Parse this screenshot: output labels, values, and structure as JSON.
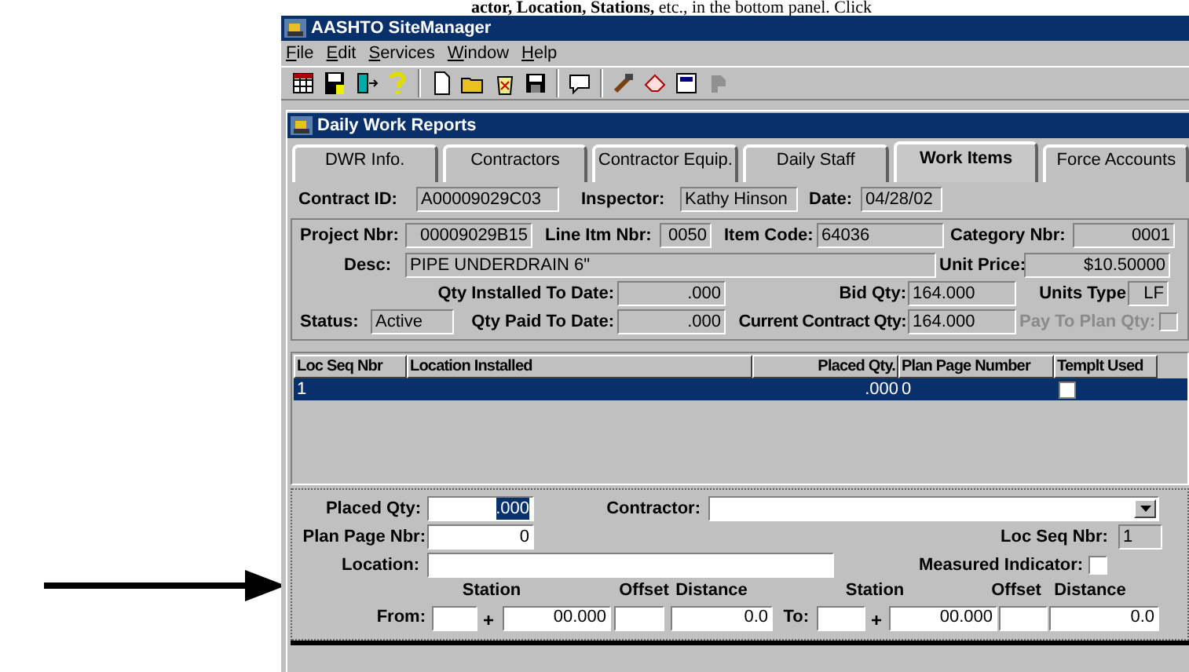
{
  "document_text": "**actor, Location, Stations,** etc., in the bottom panel.  Click",
  "app": {
    "title": "AASHTO SiteManager",
    "menu": [
      "File",
      "Edit",
      "Services",
      "Window",
      "Help"
    ]
  },
  "dialog": {
    "title": "Daily Work Reports",
    "tabs": [
      {
        "label": "DWR Info.",
        "selected": false
      },
      {
        "label": "Contractors",
        "selected": false
      },
      {
        "label": "Contractor Equip.",
        "selected": false
      },
      {
        "label": "Daily Staff",
        "selected": false
      },
      {
        "label": "Work Items",
        "selected": true
      },
      {
        "label": "Force Accounts",
        "selected": false
      }
    ],
    "contract_id": {
      "label": "Contract ID:",
      "value": "A00009029C03"
    },
    "inspector": {
      "label": "Inspector:",
      "value": "Kathy Hinson"
    },
    "date": {
      "label": "Date:",
      "value": "04/28/02"
    },
    "project_nbr": {
      "label": "Project Nbr:",
      "value": "00009029B15"
    },
    "line_item_nbr": {
      "label": "Line Itm Nbr:",
      "value": "0050"
    },
    "item_code": {
      "label": "Item Code:",
      "value": "64036"
    },
    "category_nbr": {
      "label": "Category Nbr:",
      "value": "0001"
    },
    "desc": {
      "label": "Desc:",
      "value": "PIPE UNDERDRAIN 6\""
    },
    "unit_price": {
      "label": "Unit Price:",
      "value": "$10.50000"
    },
    "qty_installed": {
      "label": "Qty Installed To Date:",
      "value": ".000"
    },
    "bid_qty": {
      "label": "Bid Qty:",
      "value": "164.000"
    },
    "units_type": {
      "label": "Units Type",
      "value": "LF"
    },
    "status": {
      "label": "Status:",
      "value": "Active"
    },
    "qty_paid": {
      "label": "Qty Paid To Date:",
      "value": ".000"
    },
    "current_contract_qty": {
      "label": "Current Contract Qty:",
      "value": "164.000"
    },
    "pay_to_plan_qty": {
      "label": "Pay To Plan Qty:",
      "checked": false,
      "disabled": true
    },
    "table": {
      "columns": [
        "Loc Seq Nbr",
        "Location Installed",
        "Placed Qty.",
        "Plan Page Number",
        "Templt Used"
      ],
      "rows": [
        {
          "loc_seq_nbr": "1",
          "placed_qty": ".000",
          "plan_page_number": "0",
          "templt_used": false,
          "selected": true
        }
      ]
    },
    "placed_qty": {
      "label": "Placed Qty:",
      "value": ".000",
      "text_selected": true
    },
    "contractor": {
      "label": "Contractor:"
    },
    "plan_page_nbr": {
      "label": "Plan Page Nbr:",
      "value": "0"
    },
    "loc_seq_nbr": {
      "label": "Loc Seq Nbr:",
      "value": "1"
    },
    "location": {
      "label": "Location:"
    },
    "measured_indicator": {
      "label": "Measured Indicator:",
      "checked": false
    },
    "station_headers": [
      "Station",
      "Offset",
      "Distance",
      "Station",
      "Offset",
      "Distance"
    ],
    "from": {
      "label": "From:",
      "plus": "+",
      "station_plus": "00.000",
      "distance": "0.0"
    },
    "to": {
      "label": "To:",
      "plus": "+",
      "station_plus": "00.000",
      "distance": "0.0"
    }
  }
}
